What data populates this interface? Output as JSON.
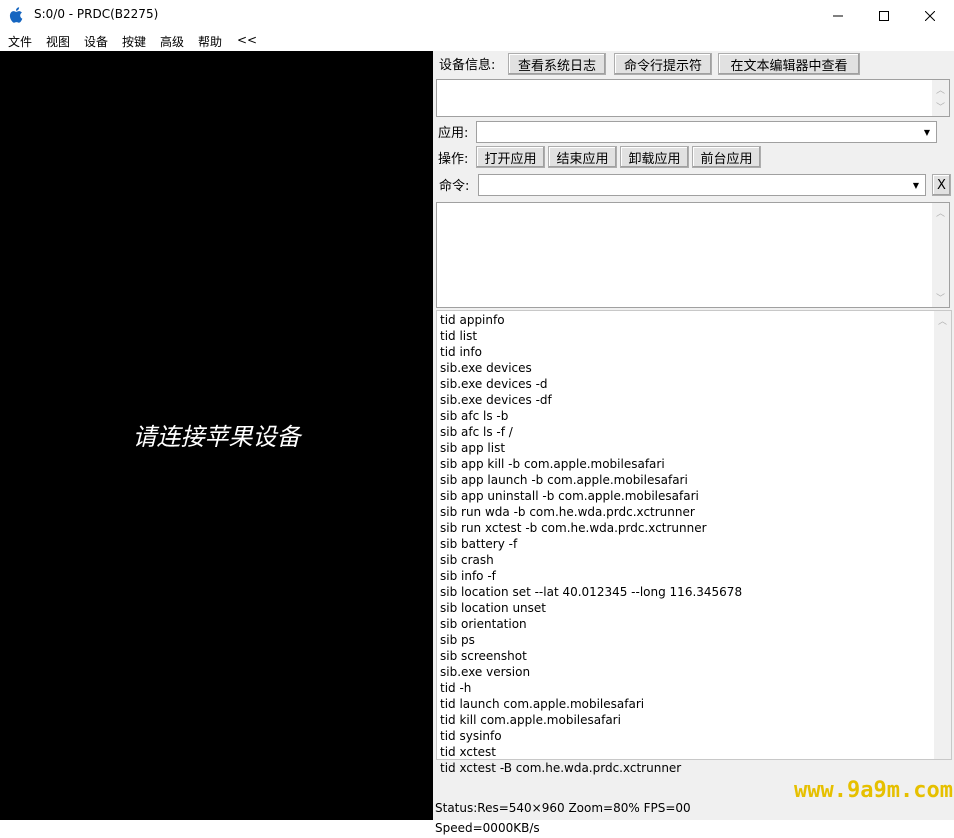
{
  "window": {
    "title": "S:0/0 - PRDC(B2275)",
    "icon": "apple-logo-icon",
    "controls": {
      "minimize": "minimize-icon",
      "maximize": "maximize-icon",
      "close": "close-icon"
    }
  },
  "menu": [
    "文件",
    "视图",
    "设备",
    "按键",
    "高级",
    "帮助",
    "<<"
  ],
  "screen": {
    "message": "请连接苹果设备"
  },
  "device_info": {
    "label": "设备信息:",
    "buttons": [
      "查看系统日志",
      "命令行提示符",
      "在文本编辑器中查看"
    ]
  },
  "app": {
    "label": "应用:",
    "selected": ""
  },
  "ops": {
    "label": "操作:",
    "buttons": [
      "打开应用",
      "结束应用",
      "卸载应用",
      "前台应用"
    ]
  },
  "command": {
    "label": "命令:",
    "value": "",
    "clear_label": "X"
  },
  "commands": [
    "tid appinfo",
    "tid list",
    "tid info",
    "sib.exe devices",
    "sib.exe devices -d",
    "sib.exe devices -df",
    "sib afc ls -b",
    "sib afc ls -f /",
    "sib app list",
    "sib app kill -b com.apple.mobilesafari",
    "sib app launch -b com.apple.mobilesafari",
    "sib app uninstall -b com.apple.mobilesafari",
    "sib run wda -b com.he.wda.prdc.xctrunner",
    "sib run xctest -b com.he.wda.prdc.xctrunner",
    "sib battery -f",
    "sib crash",
    "sib info -f",
    "sib location set --lat 40.012345  --long 116.345678",
    "sib location unset",
    "sib orientation",
    "sib ps",
    "sib screenshot",
    "sib.exe version",
    "tid -h",
    "tid launch com.apple.mobilesafari",
    "tid kill com.apple.mobilesafari",
    "tid sysinfo",
    "tid xctest",
    "tid xctest -B com.he.wda.prdc.xctrunner"
  ],
  "status": "Status:Res=540×960 Zoom=80% FPS=00 Speed=0000KB/s",
  "watermark": "www.9a9m.com"
}
